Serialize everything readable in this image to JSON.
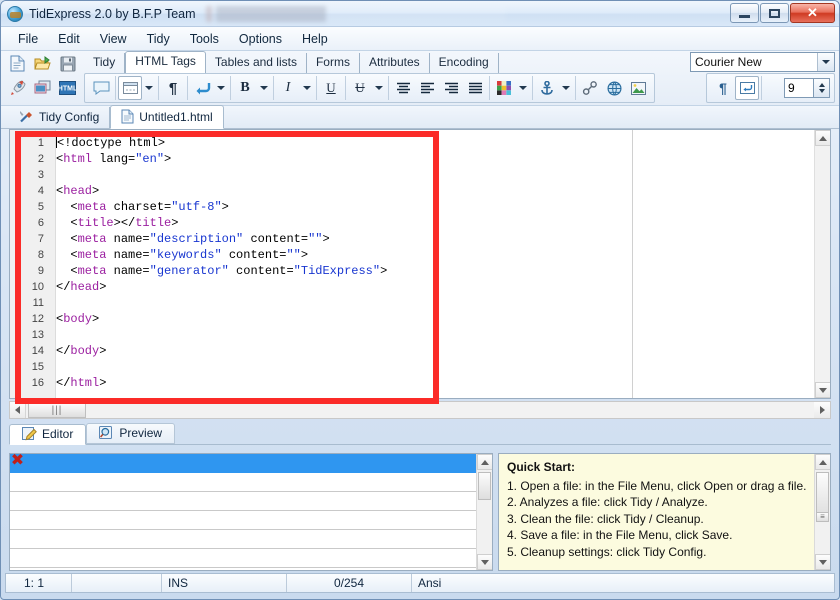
{
  "window": {
    "title": "TidExpress 2.0 by B.F.P Team",
    "app_icon": "globe-icon",
    "minimize_label": "",
    "maximize_label": "",
    "close_label": "✕"
  },
  "menu": {
    "items": [
      "File",
      "Edit",
      "View",
      "Tidy",
      "Tools",
      "Options",
      "Help"
    ]
  },
  "toolbar": {
    "file_buttons": [
      {
        "name": "new-file-icon"
      },
      {
        "name": "open-file-icon"
      },
      {
        "name": "save-file-icon"
      },
      {
        "name": "run-tidy-icon"
      },
      {
        "name": "preview-icon"
      },
      {
        "name": "html-icon"
      }
    ],
    "tag_tabs": [
      {
        "label": "Tidy",
        "active": false
      },
      {
        "label": "HTML Tags",
        "active": true
      },
      {
        "label": "Tables and lists",
        "active": false
      },
      {
        "label": "Forms",
        "active": false
      },
      {
        "label": "Attributes",
        "active": false
      },
      {
        "label": "Encoding",
        "active": false
      }
    ],
    "format_buttons": [
      "comment-icon",
      "form-icon",
      "paragraph-icon",
      "line-break-icon",
      "bold-icon",
      "italic-icon",
      "underline-icon",
      "strikethrough-icon",
      "align-center-icon",
      "align-left-icon",
      "align-right-icon",
      "align-justify-icon",
      "color-palette-icon",
      "anchor-icon",
      "link-icon",
      "globe-icon",
      "image-icon"
    ],
    "right_buttons": [
      "show-paragraph-marks-icon",
      "word-wrap-icon"
    ],
    "font_name": "Courier New",
    "font_size": "9"
  },
  "doc_tabs": [
    {
      "label": "Tidy Config",
      "icon": "tools-icon",
      "active": false
    },
    {
      "label": "Untitled1.html",
      "icon": "document-icon",
      "active": true
    }
  ],
  "editor": {
    "lines": [
      {
        "n": "1",
        "html": "<span class=\"caret-bar\"></span>&lt;!doctype html&gt;"
      },
      {
        "n": "2",
        "html": "&lt;<span class=\"tag\">html</span> lang=<span class=\"val\">\"en\"</span>&gt;"
      },
      {
        "n": "3",
        "html": ""
      },
      {
        "n": "4",
        "html": "&lt;<span class=\"tag\">head</span>&gt;"
      },
      {
        "n": "5",
        "html": "  &lt;<span class=\"tag\">meta</span> charset=<span class=\"val\">\"utf-8\"</span>&gt;"
      },
      {
        "n": "6",
        "html": "  &lt;<span class=\"tag\">title</span>&gt;&lt;/<span class=\"tag\">title</span>&gt;"
      },
      {
        "n": "7",
        "html": "  &lt;<span class=\"tag\">meta</span> name=<span class=\"val\">\"description\"</span> content=<span class=\"val\">\"\"</span>&gt;"
      },
      {
        "n": "8",
        "html": "  &lt;<span class=\"tag\">meta</span> name=<span class=\"val\">\"keywords\"</span> content=<span class=\"val\">\"\"</span>&gt;"
      },
      {
        "n": "9",
        "html": "  &lt;<span class=\"tag\">meta</span> name=<span class=\"val\">\"generator\"</span> content=<span class=\"val\">\"TidExpress\"</span>&gt;"
      },
      {
        "n": "10",
        "html": "&lt;/<span class=\"tag\">head</span>&gt;"
      },
      {
        "n": "11",
        "html": ""
      },
      {
        "n": "12",
        "html": "&lt;<span class=\"tag\">body</span>&gt;"
      },
      {
        "n": "13",
        "html": ""
      },
      {
        "n": "14",
        "html": "&lt;/<span class=\"tag\">body</span>&gt;"
      },
      {
        "n": "15",
        "html": ""
      },
      {
        "n": "16",
        "html": "&lt;/<span class=\"tag\">html</span>&gt;"
      }
    ],
    "plain_text": "<!doctype html>\n<html lang=\"en\">\n\n<head>\n  <meta charset=\"utf-8\">\n  <title></title>\n  <meta name=\"description\" content=\"\">\n  <meta name=\"keywords\" content=\"\">\n  <meta name=\"generator\" content=\"TidExpress\">\n</head>\n\n<body>\n\n</body>\n\n</html>",
    "highlight_color": "#fb2b28"
  },
  "mode_tabs": [
    {
      "label": "Editor",
      "icon": "edit-icon",
      "active": true
    },
    {
      "label": "Preview",
      "icon": "magnifier-icon",
      "active": false
    }
  ],
  "messages": {
    "error_icon": "error-x-icon",
    "rows": [
      "",
      "",
      "",
      "",
      "",
      ""
    ]
  },
  "quickstart": {
    "heading": "Quick Start:",
    "steps": [
      "1. Open a file: in the File Menu, click Open or drag a file.",
      "2. Analyzes a file: click Tidy / Analyze.",
      "3. Clean the file: click Tidy / Cleanup.",
      "4. Save a file: in the File Menu, click Save.",
      "5. Cleanup settings: click Tidy Config."
    ]
  },
  "statusbar": {
    "position": "1:  1",
    "blank": "",
    "insert_mode": "INS",
    "selection": "0/254",
    "encoding": "Ansi"
  }
}
